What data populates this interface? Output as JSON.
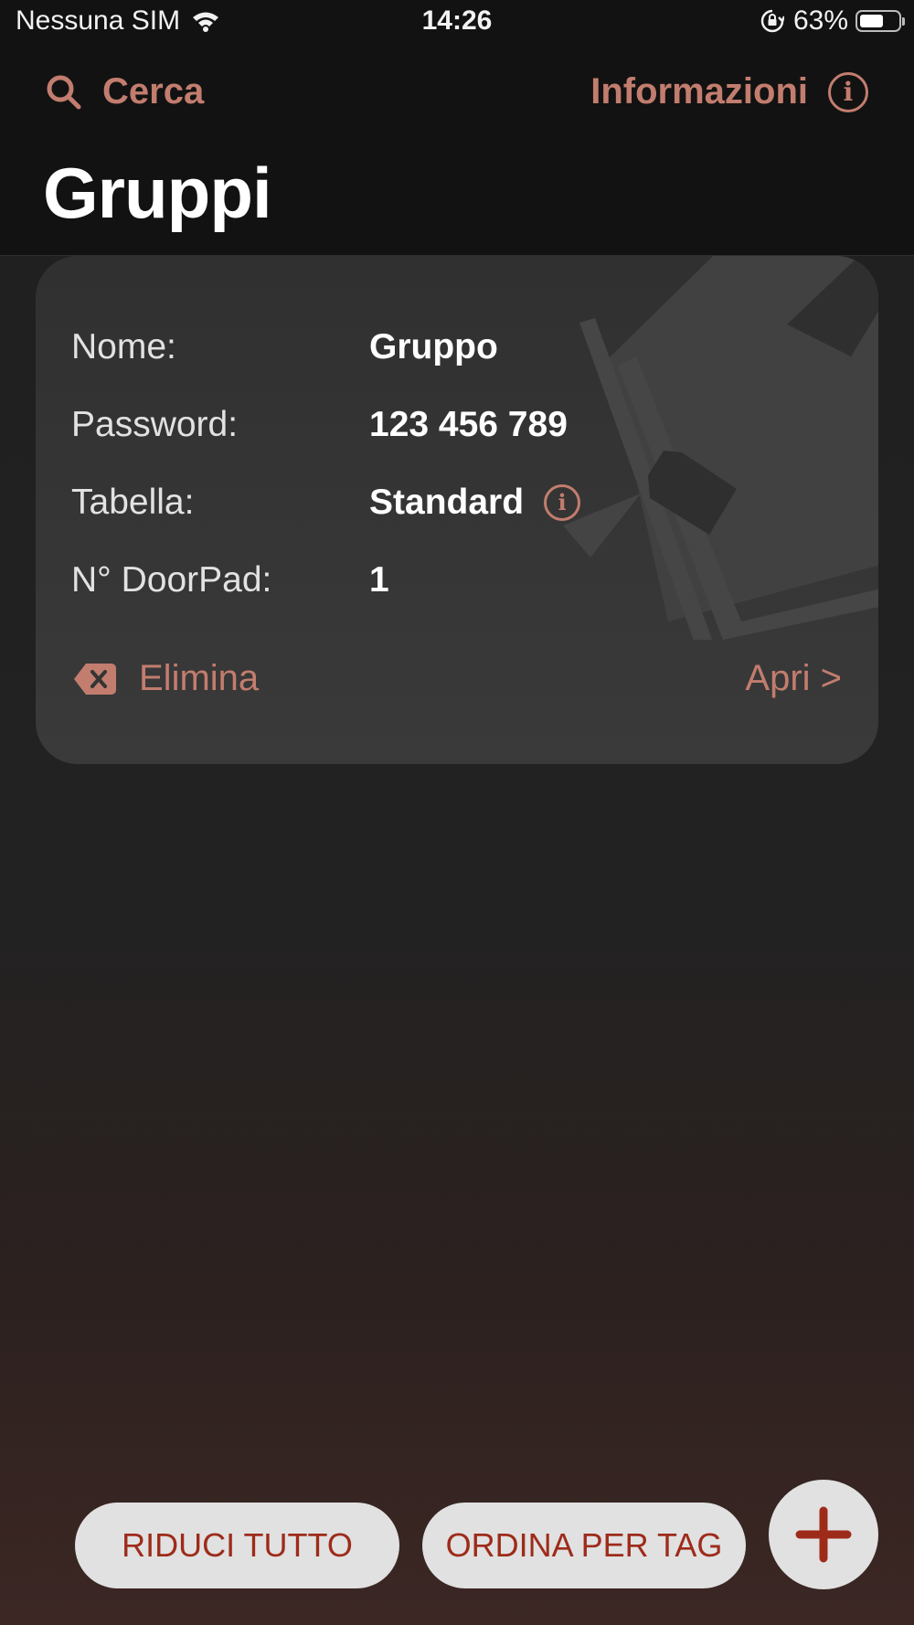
{
  "status_bar": {
    "carrier": "Nessuna SIM",
    "time": "14:26",
    "battery_percent": "63%",
    "battery_level": 0.63
  },
  "nav": {
    "search_label": "Cerca",
    "info_label": "Informazioni",
    "title": "Gruppi"
  },
  "card": {
    "rows": [
      {
        "label": "Nome:",
        "value": "Gruppo"
      },
      {
        "label": "Password:",
        "value": "123 456 789"
      },
      {
        "label": "Tabella:",
        "value": "Standard"
      },
      {
        "label": "N° DoorPad:",
        "value": "1"
      }
    ],
    "delete_label": "Elimina",
    "open_label": "Apri >"
  },
  "bottom_bar": {
    "collapse_label": "RIDUCI TUTTO",
    "sort_label": "ORDINA PER TAG"
  },
  "colors": {
    "accent": "#c27d6e",
    "button_text": "#9e2b1a",
    "button_bg": "#e1e1e1"
  }
}
